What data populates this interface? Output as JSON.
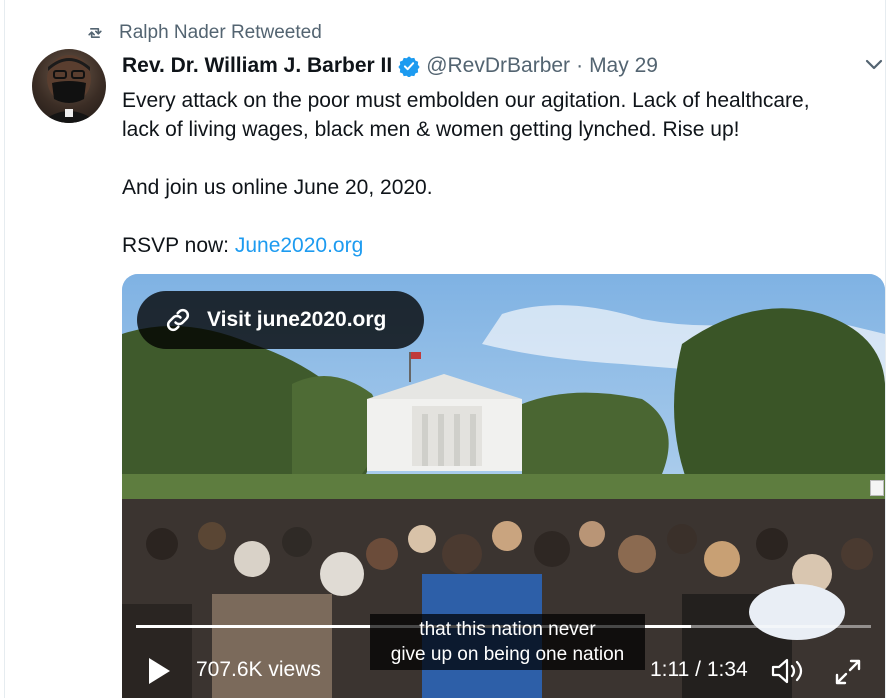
{
  "retweet": {
    "label": "Ralph Nader Retweeted",
    "icon": "retweet-icon"
  },
  "tweet": {
    "author_name": "Rev. Dr. William J. Barber II",
    "verified_icon": "verified-badge-icon",
    "handle": "@RevDrBarber",
    "separator": "·",
    "date": "May 29",
    "text_line_1": "Every attack on the poor must embolden our agitation. Lack of healthcare,",
    "text_line_2": "lack of living wages, black men & women getting lynched. Rise up!",
    "text_line_3": "And join us online June 20, 2020.",
    "rsvp_prefix": "RSVP now: ",
    "rsvp_link": "June2020.org",
    "link_color": "#1d9bf0"
  },
  "media": {
    "visit_label": "Visit june2020.org",
    "subtitle_line_1": "that this nation never",
    "subtitle_line_2": "give up on being one nation",
    "views": "707.6K views",
    "time": "1:11 / 1:34",
    "progress": 0.755
  }
}
